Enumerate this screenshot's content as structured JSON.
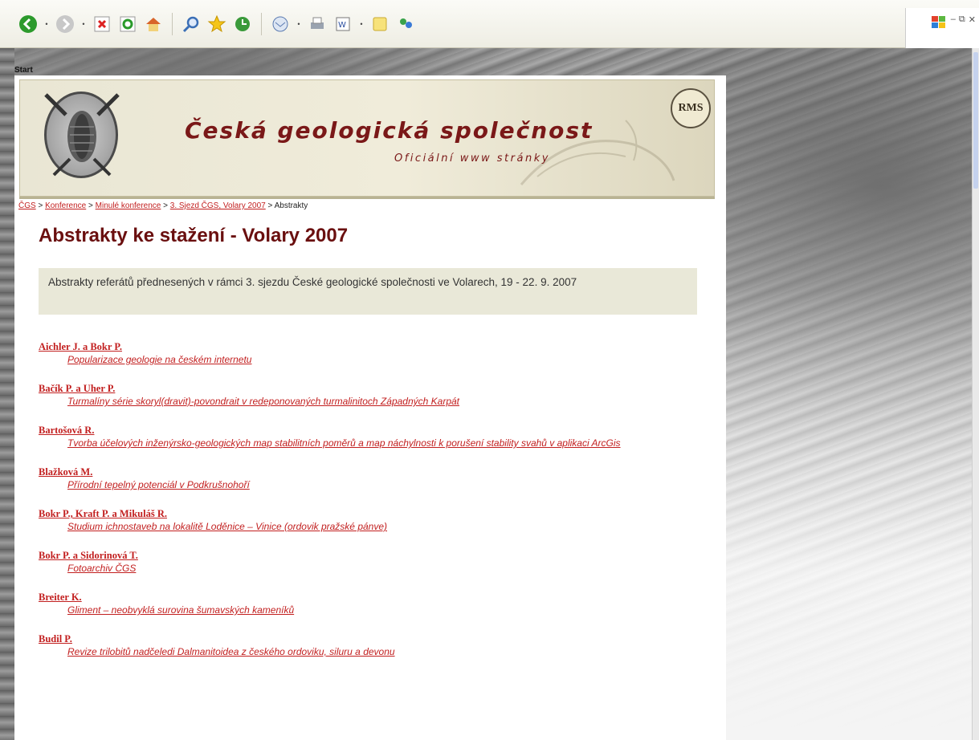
{
  "toolbar": {
    "buttons": [
      "back-icon",
      "forward-icon",
      "stop-icon",
      "refresh-icon",
      "home-icon",
      "search-icon",
      "favorites-icon",
      "history-icon",
      "mail-icon",
      "print-icon",
      "edit-icon",
      "discuss-icon",
      "messenger-icon"
    ]
  },
  "corner_label": "Start",
  "header": {
    "title": "Česká geologická společnost",
    "subtitle": "Oficiální www stránky",
    "badge": "RMS"
  },
  "breadcrumb": {
    "items": [
      "ČGS",
      "Konference",
      "Minulé konference",
      "3. Sjezd ČGS, Volary 2007"
    ],
    "current": "Abstrakty",
    "separator": ">"
  },
  "page_title": "Abstrakty ke stažení - Volary 2007",
  "intro": "Abstrakty referátů přednesených v rámci 3. sjezdu České geologické společnosti ve Volarech, 19 - 22. 9. 2007",
  "entries": [
    {
      "author": "Aichler J. a Bokr P.",
      "title": "Popularizace geologie na českém internetu"
    },
    {
      "author": "Bačík P. a Uher P.",
      "title": "Turmalíny série skoryl(dravit)-povondrait v redeponovaných turmalinitoch Západných Karpát"
    },
    {
      "author": "Bartošová R.",
      "title": "Tvorba účelových inženýrsko-geologických map stabilitních poměrů a map náchylnosti k porušení stability svahů v aplikaci ArcGis"
    },
    {
      "author": "Blažková M.",
      "title": "Přírodní tepelný potenciál v Podkrušnohoří"
    },
    {
      "author": "Bokr P., Kraft P. a Mikuláš R.",
      "title": "Studium ichnostaveb na lokalitě Loděnice – Vinice (ordovik pražské pánve)"
    },
    {
      "author": "Bokr P. a Sidorinová T.",
      "title": "Fotoarchiv ČGS"
    },
    {
      "author": "Breiter K.",
      "title": "Gliment – neobvyklá surovina šumavských kameníků"
    },
    {
      "author": "Budil P.",
      "title": "Revize trilobitů nadčeledi Dalmanitoidea z českého ordoviku, siluru a devonu"
    }
  ]
}
